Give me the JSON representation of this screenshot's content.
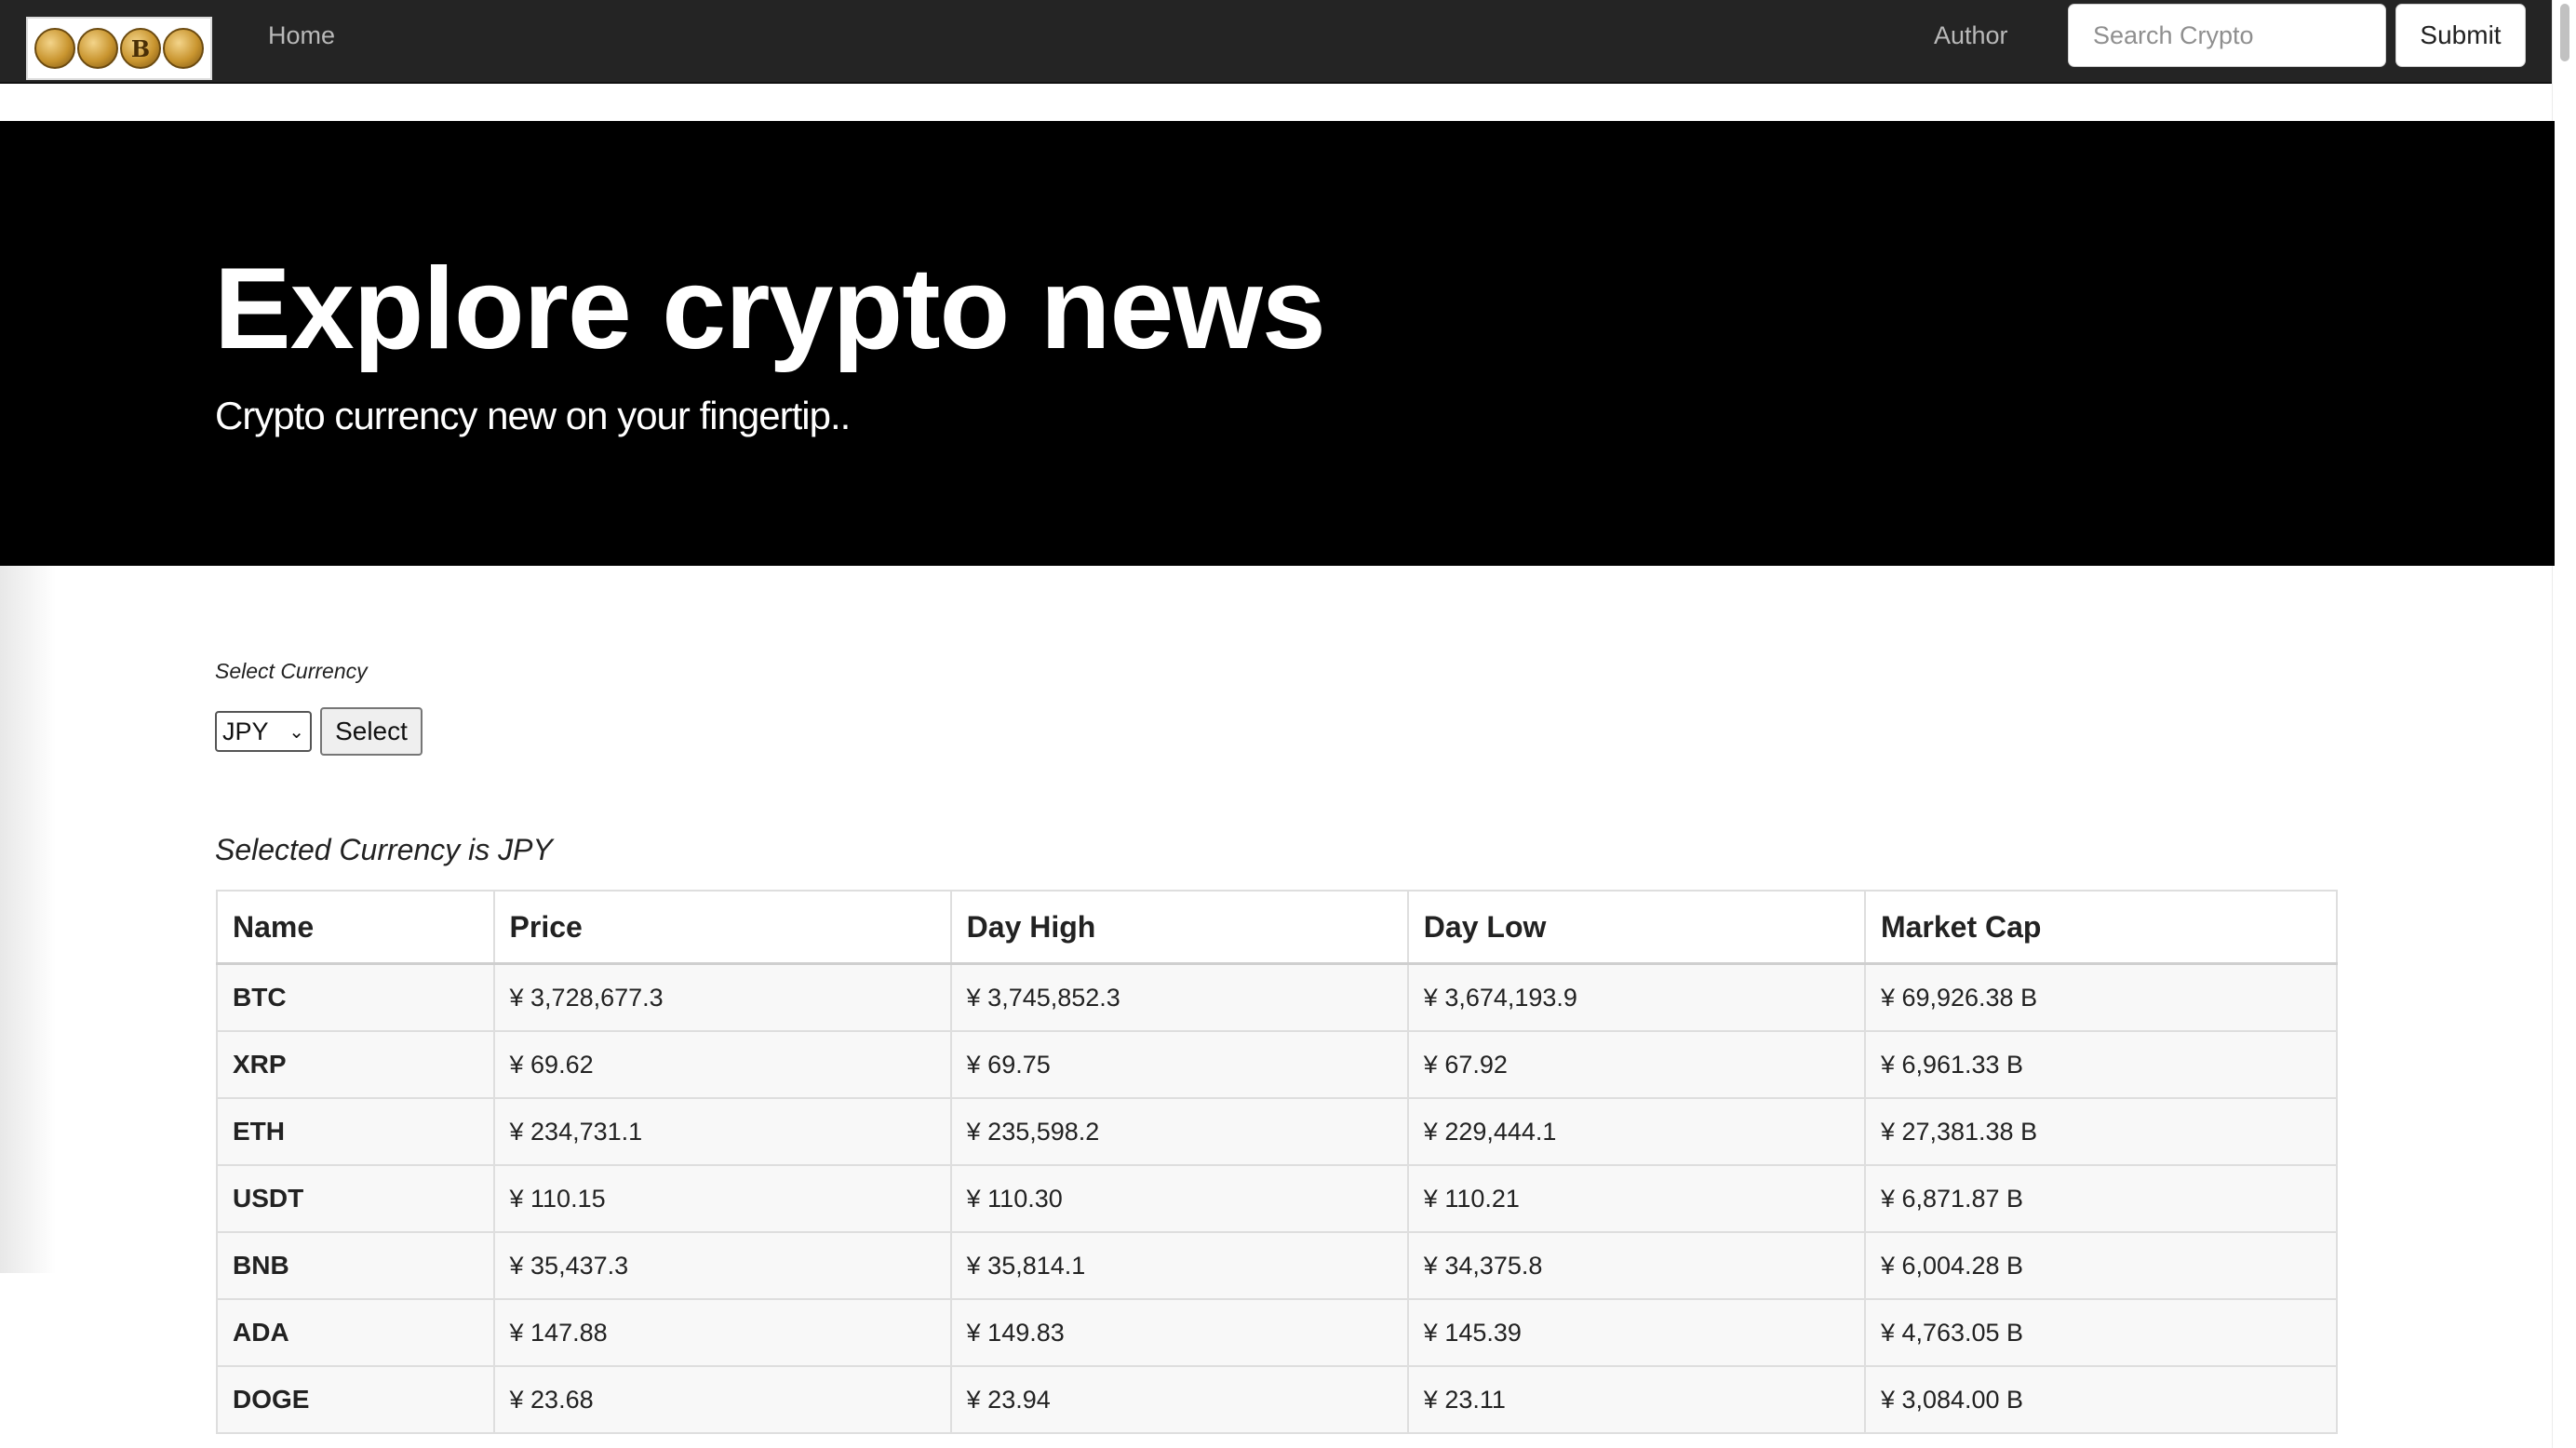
{
  "navbar": {
    "logo_letters": [
      "",
      "",
      "B",
      "",
      ""
    ],
    "home_label": "Home",
    "author_label": "Author",
    "search_placeholder": "Search Crypto",
    "submit_label": "Submit"
  },
  "hero": {
    "title": "Explore crypto news",
    "subtitle": "Crypto currency new on your fingertip.."
  },
  "currency": {
    "select_label": "Select Currency",
    "selected_value": "JPY",
    "select_button": "Select",
    "selected_text": "Selected Currency is JPY"
  },
  "table": {
    "headers": [
      "Name",
      "Price",
      "Day High",
      "Day Low",
      "Market Cap"
    ],
    "rows": [
      {
        "name": "BTC",
        "price": "¥ 3,728,677.3",
        "high": "¥ 3,745,852.3",
        "low": "¥ 3,674,193.9",
        "cap": "¥ 69,926.38 B"
      },
      {
        "name": "XRP",
        "price": "¥ 69.62",
        "high": "¥ 69.75",
        "low": "¥ 67.92",
        "cap": "¥ 6,961.33 B"
      },
      {
        "name": "ETH",
        "price": "¥ 234,731.1",
        "high": "¥ 235,598.2",
        "low": "¥ 229,444.1",
        "cap": "¥ 27,381.38 B"
      },
      {
        "name": "USDT",
        "price": "¥ 110.15",
        "high": "¥ 110.30",
        "low": "¥ 110.21",
        "cap": "¥ 6,871.87 B"
      },
      {
        "name": "BNB",
        "price": "¥ 35,437.3",
        "high": "¥ 35,814.1",
        "low": "¥ 34,375.8",
        "cap": "¥ 6,004.28 B"
      },
      {
        "name": "ADA",
        "price": "¥ 147.88",
        "high": "¥ 149.83",
        "low": "¥ 145.39",
        "cap": "¥ 4,763.05 B"
      },
      {
        "name": "DOGE",
        "price": "¥ 23.68",
        "high": "¥ 23.94",
        "low": "¥ 23.11",
        "cap": "¥ 3,084.00 B"
      }
    ]
  },
  "colors": {
    "navbar_bg": "#242424",
    "hero_bg": "#000000",
    "nav_link": "#b9b9b9"
  }
}
